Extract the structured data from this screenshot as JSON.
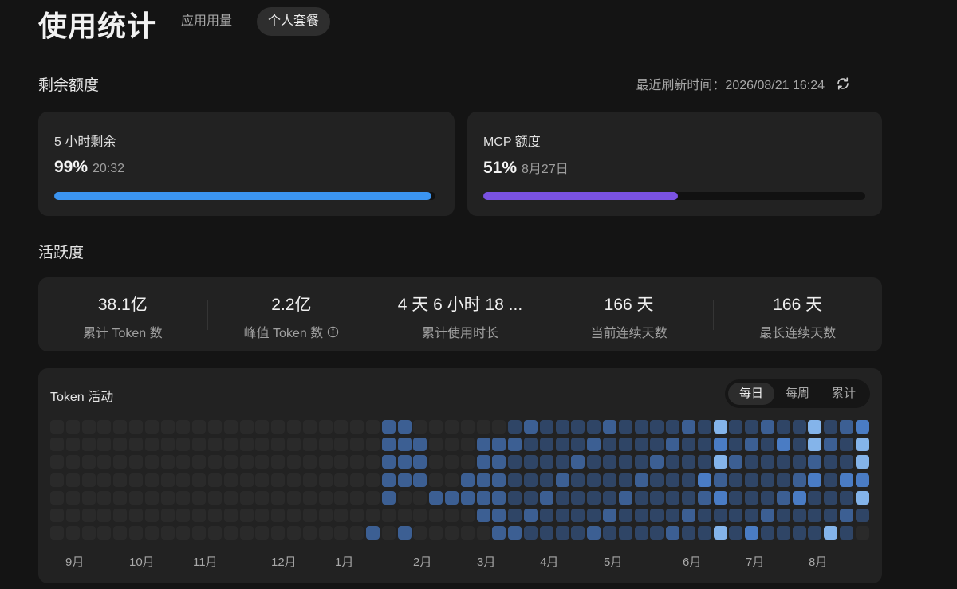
{
  "header": {
    "title": "使用统计",
    "tabs": [
      {
        "label": "应用用量",
        "active": false
      },
      {
        "label": "个人套餐",
        "active": true
      }
    ]
  },
  "quota": {
    "title": "剩余额度",
    "refresh_text": "最近刷新时间：2026/08/21 16:24",
    "refresh_icon": "refresh-icon",
    "cards": [
      {
        "label": "5 小时剩余",
        "percent": "99%",
        "sub": "20:32",
        "level": 0.99,
        "color": "#3b94f0"
      },
      {
        "label": "MCP 额度",
        "percent": "51%",
        "sub": "8月27日",
        "level": 0.51,
        "color": "#7a52e3"
      }
    ]
  },
  "activity": {
    "title": "活跃度",
    "stats": [
      {
        "value": "38.1亿",
        "label": "累计 Token 数"
      },
      {
        "value": "2.2亿",
        "label": "峰值 Token 数",
        "icon": "info-icon"
      },
      {
        "value": "4 天 6 小时 18 ...",
        "label": "累计使用时长"
      },
      {
        "value": "166 天",
        "label": "当前连续天数"
      },
      {
        "value": "166 天",
        "label": "最长连续天数"
      }
    ]
  },
  "token_activity": {
    "title": "Token 活动",
    "view_options": [
      {
        "label": "每日",
        "active": true
      },
      {
        "label": "每周",
        "active": false
      },
      {
        "label": "累计",
        "active": false
      }
    ],
    "months": [
      "9月",
      "10月",
      "11月",
      "12月",
      "1月",
      "2月",
      "3月",
      "4月",
      "5月",
      "6月",
      "7月",
      "8月"
    ],
    "colors": [
      "#2a2a2a",
      "#2f4566",
      "#3c5f93",
      "#4a7cc4",
      "#84b4ea"
    ]
  }
}
